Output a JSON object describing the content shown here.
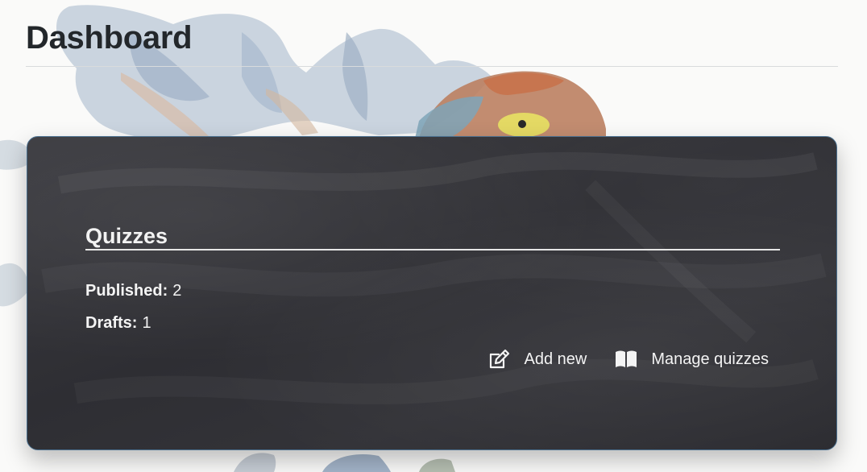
{
  "page": {
    "title": "Dashboard"
  },
  "quizzes_card": {
    "title": "Quizzes",
    "stats": [
      {
        "label": "Published:",
        "value": "2"
      },
      {
        "label": "Drafts:",
        "value": "1"
      }
    ],
    "actions": [
      {
        "label": "Add new",
        "icon": "edit-icon"
      },
      {
        "label": "Manage quizzes",
        "icon": "book-open-icon"
      }
    ]
  },
  "colors": {
    "background": "#fafaf9",
    "title_text": "#23272b",
    "card_background": "#333338",
    "card_border": "#4a6f8e",
    "card_text": "#f4f4f4"
  }
}
